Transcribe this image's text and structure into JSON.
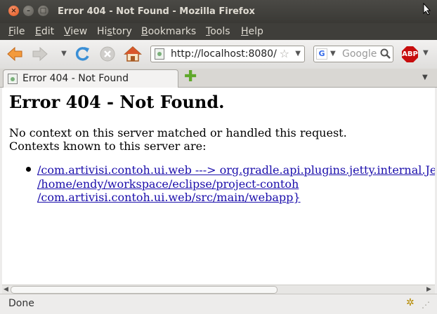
{
  "window": {
    "title": "Error 404 - Not Found - Mozilla Firefox",
    "controls": {
      "close": "×",
      "minimize": "–",
      "maximize": "□"
    }
  },
  "menubar": {
    "items": [
      {
        "label_u": "F",
        "label_rest": "ile"
      },
      {
        "label_u": "E",
        "label_rest": "dit"
      },
      {
        "label_u": "V",
        "label_rest": "iew"
      },
      {
        "label_u": "",
        "label_pre": "Hi",
        "label_u2": "s",
        "label_rest": "tory"
      },
      {
        "label_u": "B",
        "label_rest": "ookmarks"
      },
      {
        "label_u": "T",
        "label_rest": "ools"
      },
      {
        "label_u": "H",
        "label_rest": "elp"
      }
    ]
  },
  "navbar": {
    "url": "http://localhost:8080/",
    "search_placeholder": "Google",
    "search_engine_icon": "G",
    "adblock_label": "ABP",
    "icons": {
      "back": "back-arrow-icon",
      "forward": "forward-arrow-icon",
      "reload": "reload-icon",
      "stop": "stop-icon",
      "home": "home-icon"
    }
  },
  "tabs": [
    {
      "label": "Error 404 - Not Found",
      "active": true
    }
  ],
  "page": {
    "heading": "Error 404 - Not Found.",
    "line1": "No context on this server matched or handled this request.",
    "line2": "Contexts known to this server are:",
    "context_link": {
      "line1": "/com.artivisi.contoh.ui.web ---> org.gradle.api.plugins.jetty.internal.JettyPluginWebAppContext@",
      "line2": "/home/endy/workspace/eclipse/project-contoh",
      "line3": "/com.artivisi.contoh.ui.web/src/main/webapp}"
    }
  },
  "status": {
    "text": "Done"
  },
  "colors": {
    "titlebar": "#3c3b37",
    "link": "#1a0dab",
    "adblock": "#c70d0d"
  }
}
